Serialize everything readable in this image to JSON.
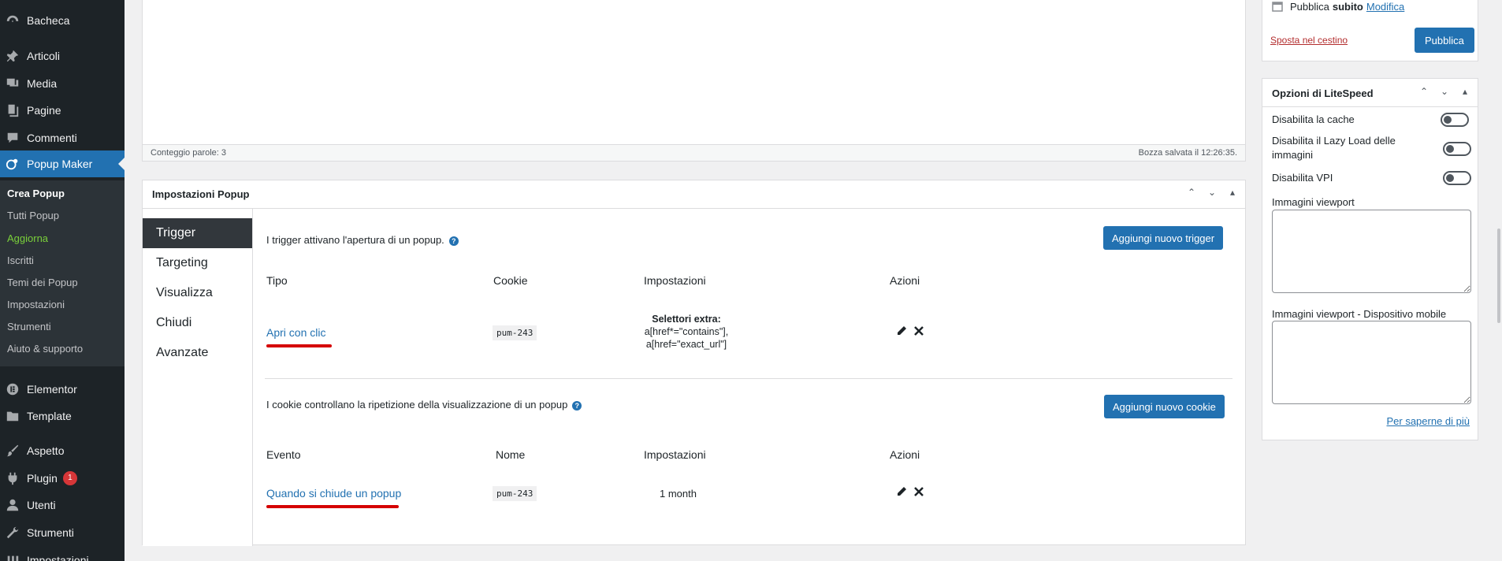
{
  "sidebar": {
    "items": [
      {
        "label": "Bacheca",
        "icon": "dashboard-icon"
      },
      {
        "label": "Articoli",
        "icon": "pin-icon"
      },
      {
        "label": "Media",
        "icon": "media-icon"
      },
      {
        "label": "Pagine",
        "icon": "pages-icon"
      },
      {
        "label": "Commenti",
        "icon": "comment-icon"
      },
      {
        "label": "Popup Maker",
        "icon": "popup-maker-icon"
      },
      {
        "label": "Elementor",
        "icon": "elementor-icon"
      },
      {
        "label": "Template",
        "icon": "folder-icon"
      },
      {
        "label": "Aspetto",
        "icon": "brush-icon"
      },
      {
        "label": "Plugin",
        "icon": "plugin-icon",
        "badge": "1"
      },
      {
        "label": "Utenti",
        "icon": "user-icon"
      },
      {
        "label": "Strumenti",
        "icon": "wrench-icon"
      },
      {
        "label": "Impostazioni",
        "icon": "settings-icon"
      }
    ],
    "submenu": [
      {
        "label": "Crea Popup"
      },
      {
        "label": "Tutti Popup"
      },
      {
        "label": "Aggiorna"
      },
      {
        "label": "Iscritti"
      },
      {
        "label": "Temi dei Popup"
      },
      {
        "label": "Impostazioni"
      },
      {
        "label": "Strumenti"
      },
      {
        "label": "Aiuto & supporto"
      }
    ]
  },
  "editor": {
    "word_count": "Conteggio parole: 3",
    "draft_saved": "Bozza salvata il 12:26:35."
  },
  "popup_settings": {
    "title": "Impostazioni Popup",
    "tabs": [
      "Trigger",
      "Targeting",
      "Visualizza",
      "Chiudi",
      "Avanzate"
    ],
    "triggers": {
      "intro": "I trigger attivano l'apertura di un popup.",
      "add_button": "Aggiungi nuovo trigger",
      "columns": [
        "Tipo",
        "Cookie",
        "Impostazioni",
        "Azioni"
      ],
      "row": {
        "type": "Apri con clic",
        "cookie": "pum-243",
        "settings_title": "Selettori extra:",
        "settings_line1": "a[href*=\"contains\"],",
        "settings_line2": "a[href=\"exact_url\"]"
      }
    },
    "cookies": {
      "intro": "I cookie controllano la ripetizione della visualizzazione di un popup",
      "add_button": "Aggiungi nuovo cookie",
      "columns": [
        "Evento",
        "Nome",
        "Impostazioni",
        "Azioni"
      ],
      "row": {
        "event": "Quando si chiude un popup",
        "name": "pum-243",
        "settings": "1 month"
      }
    },
    "accent_color": "#2271b1",
    "highlight_color": "#d50000"
  },
  "publish": {
    "schedule_label": "Pubblica",
    "schedule_value": "subito",
    "edit_link": "Modifica",
    "trash_link": "Sposta nel cestino",
    "publish_button": "Pubblica"
  },
  "litespeed": {
    "title": "Opzioni di LiteSpeed",
    "options": [
      {
        "label": "Disabilita la cache",
        "enabled": false
      },
      {
        "label": "Disabilita il Lazy Load delle immagini",
        "enabled": false
      },
      {
        "label": "Disabilita VPI",
        "enabled": false
      }
    ],
    "viewport_label": "Immagini viewport",
    "viewport_mobile_label": "Immagini viewport - Dispositivo mobile",
    "learn_more": "Per saperne di più"
  }
}
